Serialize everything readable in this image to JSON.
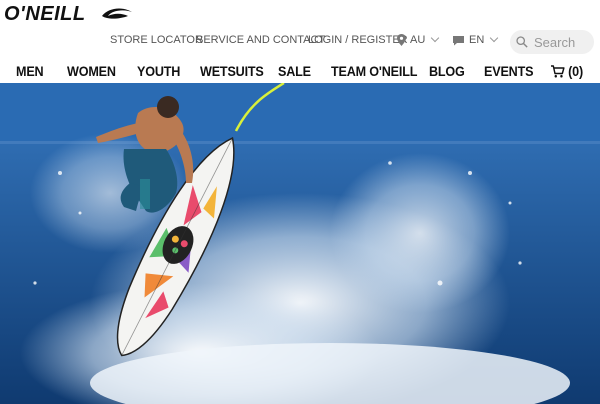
{
  "brand": {
    "name": "O'NEILL",
    "logo": "wave-logo"
  },
  "utility": {
    "store_locator": "STORE LOCATOR",
    "service": "SERVICE AND CONTACT",
    "login": "LOGIN / REGISTER",
    "region": "AU",
    "language": "EN"
  },
  "search": {
    "placeholder": "Search"
  },
  "nav": {
    "men": "MEN",
    "women": "WOMEN",
    "youth": "YOUTH",
    "wetsuits": "WETSUITS",
    "sale": "SALE",
    "team": "TEAM O'NEILL",
    "blog": "BLOG",
    "events": "EVENTS",
    "cart": "(0)"
  },
  "colors": {
    "text": "#111111",
    "muted": "#555555",
    "ocean": "#164582",
    "search_bg": "#f0f0f0"
  },
  "icons": [
    "wave-logo",
    "location-pin-icon",
    "chat-bubble-icon",
    "chevron-down-icon",
    "search-icon",
    "cart-icon"
  ]
}
